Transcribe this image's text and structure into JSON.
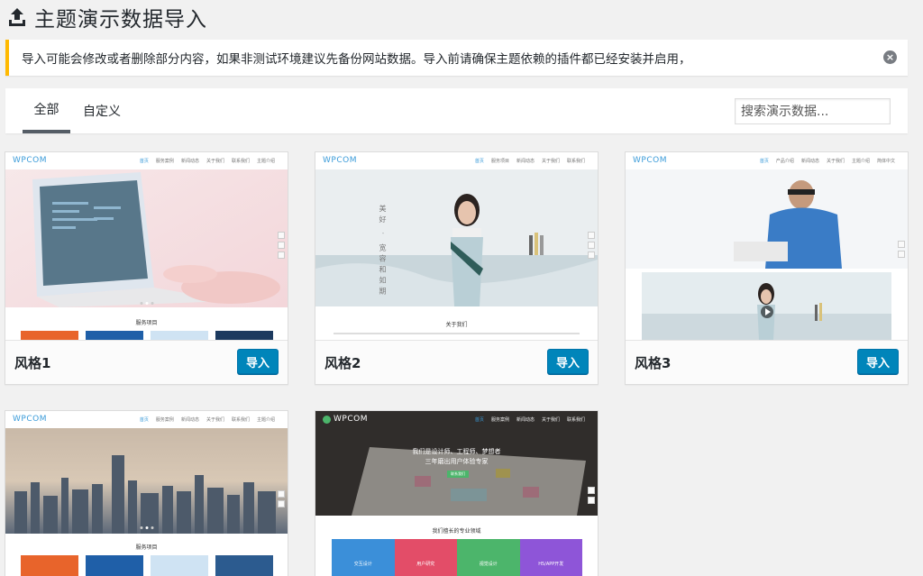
{
  "page": {
    "title": "主题演示数据导入",
    "icon": "upload-icon"
  },
  "notice": {
    "text": "导入可能会修改或者删除部分内容，如果非测试环境建议先备份网站数据。导入前请确保主题依赖的插件都已经安装并启用，",
    "dismiss_icon": "close-circle-icon",
    "border_color": "#ffb900"
  },
  "filters": {
    "tabs": [
      {
        "label": "全部",
        "active": true
      },
      {
        "label": "自定义",
        "active": false
      }
    ],
    "search_placeholder": "搜索演示数据..."
  },
  "cards": [
    {
      "name": "风格1",
      "import_label": "导入",
      "preview": {
        "logo": "WPCOM",
        "nav": [
          "首页",
          "服务案例",
          "新闻动态",
          "关于我们",
          "联系我们",
          "主题介绍"
        ],
        "section": "服务项目"
      }
    },
    {
      "name": "风格2",
      "import_label": "导入",
      "preview": {
        "logo": "WPCOM",
        "nav": [
          "首页",
          "服务项目",
          "新闻动态",
          "关于我们",
          "联系我们"
        ],
        "section": "关于我们",
        "hero_text": "美好 · 宽容和如期"
      }
    },
    {
      "name": "风格3",
      "import_label": "导入",
      "preview": {
        "logo": "WPCOM",
        "nav": [
          "首页",
          "产品介绍",
          "新闻动态",
          "关于我们",
          "主题介绍",
          "简体中文"
        ]
      }
    },
    {
      "name": "",
      "import_label": "",
      "preview": {
        "logo": "WPCOM",
        "nav": [
          "首页",
          "服务案例",
          "新闻动态",
          "关于我们",
          "联系我们",
          "主题介绍"
        ],
        "section": "服务项目"
      }
    },
    {
      "name": "",
      "import_label": "",
      "preview": {
        "logo": "WPCOM",
        "nav": [
          "首页",
          "服务案例",
          "新闻动态",
          "关于我们",
          "联系我们"
        ],
        "hero_line1": "我们是设计师、工程师、梦想者",
        "hero_line2": "三年磨出用户体验专家",
        "hero_btn": "联系我们",
        "section": "我们擅长的专业领域",
        "services": [
          "交互设计",
          "用户研究",
          "视觉设计",
          "H5/APP开发"
        ]
      }
    }
  ],
  "colors": {
    "primary_button": "#0085ba",
    "brand_blue": "#3a9bd9",
    "service_colors": [
      "#3b8fd9",
      "#e34d68",
      "#4cb56b",
      "#8e55d8"
    ]
  }
}
